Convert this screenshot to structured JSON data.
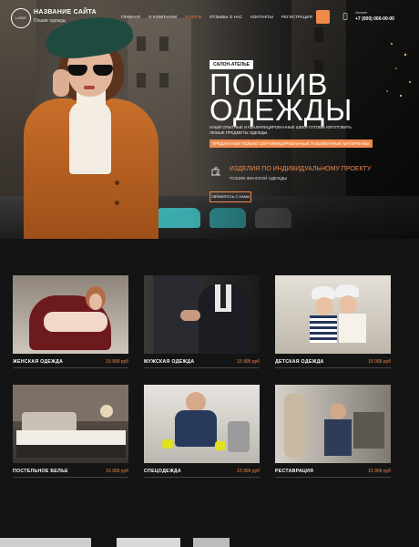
{
  "header": {
    "logo_text": "LOGO",
    "site_name": "НАЗВАНИЕ САЙТА",
    "site_sub": "Пошив одежды",
    "nav": [
      "ГЛАВНАЯ",
      "О КОМПАНИИ",
      "УСЛУГИ",
      "ОТЗЫВЫ О НАС",
      "КОНТАКТЫ",
      "РЕГИСТРАЦИЯ"
    ],
    "active_nav": "УСЛУГИ",
    "call_label": "Звоните",
    "phone": "+7 (000) 000-00-00"
  },
  "hero": {
    "tag": "САЛОН-АТЕЛЬЕ",
    "title_line1": "ПОШИВ",
    "title_line2": "ОДЕЖДЫ",
    "description": "НАШИ ОПЫТНЫЕ И КВАЛИФИЦИРОВАННЫЕ ШВЕИ ГОТОВЫ ИЗГОТОВИТЬ ЛЮБЫЕ ПРЕДМЕТЫ ОДЕЖДЫ.",
    "strip": "ПРЕДЛАГАЕМ ТОЛЬКО СЕРТИФИЦИРОВАННЫЕ ПОШИВОЧНЫЕ МАТЕРИАЛЫ",
    "feature_title": "ИЗДЕЛИЯ ПО ИНДИВИДУАЛЬНОМУ ПРОЕКТУ",
    "feature_sub": "ПОШИВ ЖЕНСКОЙ ОДЕЖДЫ",
    "button": "СВЯЖИТЕСЬ С НАМИ"
  },
  "products": [
    {
      "name": "ЖЕНСКАЯ ОДЕЖДА",
      "price": "15 999 руб"
    },
    {
      "name": "МУЖСКАЯ ОДЕЖДА",
      "price": "15 999 руб"
    },
    {
      "name": "ДЕТСКАЯ ОДЕЖДА",
      "price": "15 999 руб"
    },
    {
      "name": "ПОСТЕЛЬНОЕ БЕЛЬЕ",
      "price": "15 999 руб"
    },
    {
      "name": "СПЕЦОДЕЖДА",
      "price": "15 999 руб"
    },
    {
      "name": "РЕСТАВРАЦИЯ",
      "price": "15 999 руб"
    }
  ],
  "colors": {
    "accent": "#f08a4b",
    "background": "#141414"
  }
}
